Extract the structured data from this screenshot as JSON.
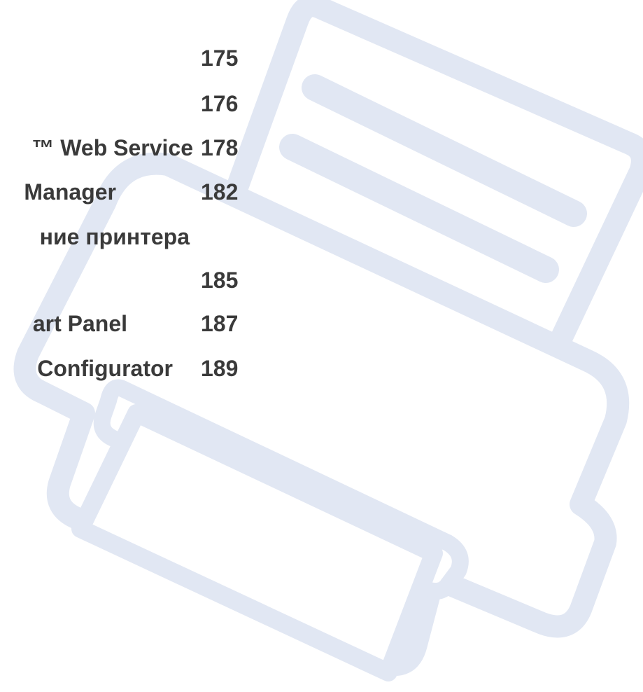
{
  "toc": {
    "entries": [
      {
        "text": "",
        "page": "175"
      },
      {
        "text": "",
        "page": "176"
      },
      {
        "text": "™ Web Service",
        "page": "178"
      },
      {
        "text": "Manager",
        "page": "182"
      },
      {
        "text": "ние принтера",
        "page": ""
      },
      {
        "text": "",
        "page": "185"
      },
      {
        "text": "art Panel",
        "page": "187"
      },
      {
        "text": "Configurator",
        "page": "189"
      }
    ]
  },
  "colors": {
    "printer_illustration": "#e1e7f3",
    "illustration_fill": "#ffffff",
    "text": "#3a3a3a"
  },
  "icons": {
    "illustration": "printer-illustration"
  }
}
